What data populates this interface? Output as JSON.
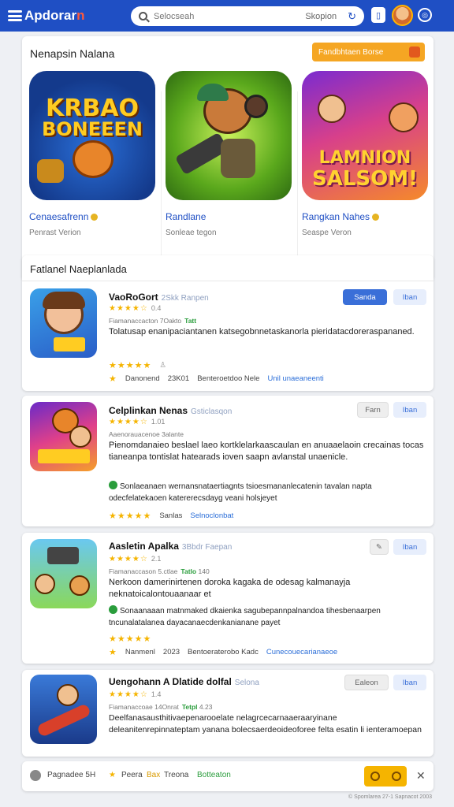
{
  "header": {
    "logo_main": "Apdorar",
    "logo_accent": "n",
    "search_placeholder": "Selocseah",
    "search_filter": "Skopion",
    "search_refresh": "↻"
  },
  "featured": {
    "title": "Nenapsin Nalana",
    "button_label": "Fandbhtaen Borse",
    "items": [
      {
        "name": "Cenaesafrenn",
        "sub": "Penrast Verion",
        "art_line1": "KRBAO",
        "art_line2": "BONEEEN"
      },
      {
        "name": "Randlane",
        "sub": "Sonleae tegon",
        "art_line1": "",
        "art_line2": ""
      },
      {
        "name": "Rangkan Nahes",
        "sub": "Seaspe Veron",
        "art_line1": "LAMNION",
        "art_line2": "SALSOM!"
      }
    ]
  },
  "list": {
    "title": "Fatlanel Naeplanlada",
    "apps": [
      {
        "name": "VaoRoGort",
        "tagline": "2Skk Ranpen",
        "rating": "0.4",
        "meta": "Fiamanaccacton 7Oakto",
        "tag": "Tatt",
        "desc": "Tolatusap enanipaciantanen katsegobnnetaskanorla pieridatacdoreraspananed.",
        "foot_label": "Danonend",
        "foot_count": "23K01",
        "foot_extra": "Benteroetdoo Nele",
        "foot_link": "Unil unaeaneenti",
        "btn_primary": "Sanda",
        "btn_secondary": "Iban"
      },
      {
        "name": "Celplinkan Nenas",
        "tagline": "Gsticlasqon",
        "rating": "1.01",
        "meta": "Aaenorauacenoe 3alante",
        "desc": "Pienomdanaieo beslael laeo kortklelarkaascaulan en anuaaelaoin crecainas tocas tianeanpa tontislat hatearads ioven saapn avlanstal unaenicle.",
        "bullet": "Sonlaeanaen wernansnataertiagnts tsioesmananlecatenin tavalan napta odecfelatekaoen katererecsdayg veani holsjeyet",
        "foot_label": "Sanlas",
        "foot_link": "Selnoclonbat",
        "btn_grey": "Farn",
        "btn_secondary": "Iban"
      },
      {
        "name": "Aasletin Apalka",
        "tagline": "3Bbdr Faepan",
        "rating": "2.1",
        "meta": "Fiamanaccason 5.ctlae",
        "tag": "Tatlo",
        "tag2": "140",
        "desc": "Nerkoon damerinirtenen doroka kagaka de odesag kalmanayja neknatoicalontouaanaar et",
        "bullet": "Sonaanaaan matnmaked dkaienka sagubepannpalnandoa tihesbenaarpen tncunalatalanea dayacanaecdenkanianane payet",
        "foot_label": "Nanmenl",
        "foot_count": "2023",
        "foot_extra": "Bentoeraterobo Kadc",
        "foot_link": "Cunecouecarianaeoe",
        "btn_secondary": "Iban"
      },
      {
        "name": "Uengohann A Dlatide dolfal",
        "tagline": "Selona",
        "rating": "1.4",
        "meta": "Fiamanaccoae 14Onrat",
        "tag": "Tetpl",
        "tag2": "4.23",
        "desc": "Deelfanasausthitivaepenarooelate nelagrcecarnaaeraaryinane deleanitenrepinnateptam yanana bolecsaerdeoideoforee felta esatin li ienteramoepan",
        "btn_grey": "Ealeon",
        "btn_secondary": "Iban"
      }
    ]
  },
  "bottom_bar": {
    "item1": "Pagnadee 5H",
    "item2": "Peera",
    "item3": "Bax",
    "item4": "Treona",
    "link": "Botteaton"
  },
  "copyright": "© Spomlarea 27-1 Sapnacot 2003"
}
